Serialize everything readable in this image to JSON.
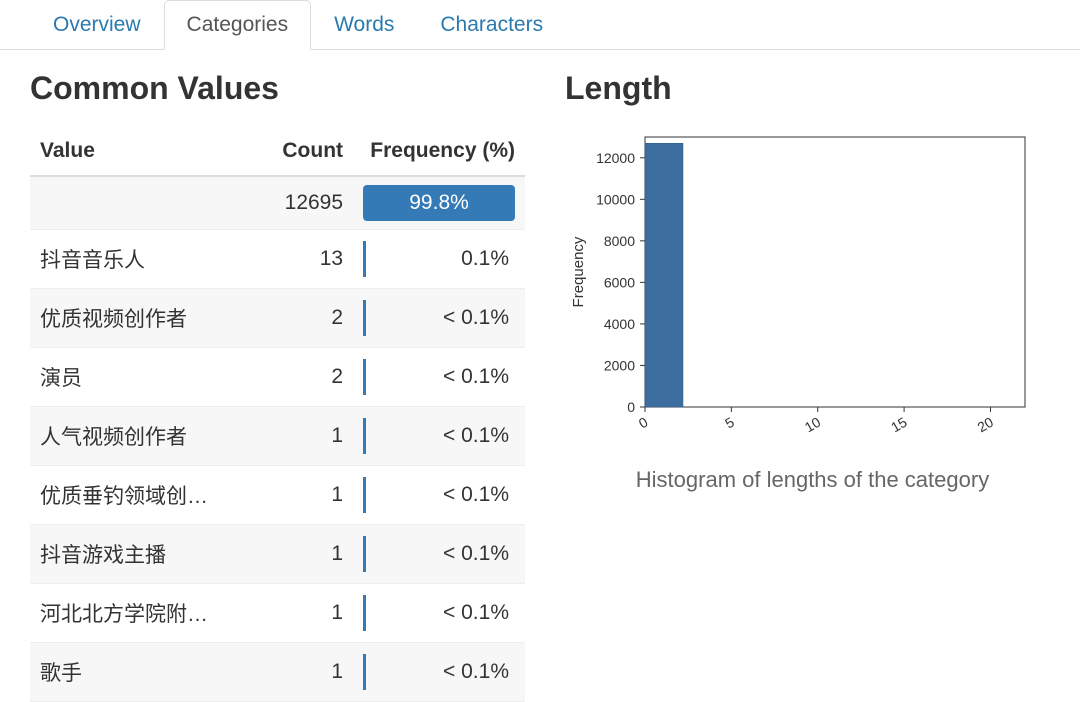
{
  "tabs": [
    {
      "label": "Overview",
      "active": false
    },
    {
      "label": "Categories",
      "active": true
    },
    {
      "label": "Words",
      "active": false
    },
    {
      "label": "Characters",
      "active": false
    }
  ],
  "left_title": "Common Values",
  "right_title": "Length",
  "columns": {
    "value": "Value",
    "count": "Count",
    "freq": "Frequency (%)"
  },
  "rows": [
    {
      "value": "",
      "count": "12695",
      "freq": "99.8%",
      "bar_pct": 99.8
    },
    {
      "value": "抖音音乐人",
      "count": "13",
      "freq": "0.1%",
      "bar_pct": 0.1
    },
    {
      "value": "优质视频创作者",
      "count": "2",
      "freq": "< 0.1%",
      "bar_pct": 0.05
    },
    {
      "value": "演员",
      "count": "2",
      "freq": "< 0.1%",
      "bar_pct": 0.05
    },
    {
      "value": "人气视频创作者",
      "count": "1",
      "freq": "< 0.1%",
      "bar_pct": 0.05
    },
    {
      "value": "优质垂钓领域创…",
      "count": "1",
      "freq": "< 0.1%",
      "bar_pct": 0.05
    },
    {
      "value": "抖音游戏主播",
      "count": "1",
      "freq": "< 0.1%",
      "bar_pct": 0.05
    },
    {
      "value": "河北北方学院附…",
      "count": "1",
      "freq": "< 0.1%",
      "bar_pct": 0.05
    },
    {
      "value": "歌手",
      "count": "1",
      "freq": "< 0.1%",
      "bar_pct": 0.05
    }
  ],
  "chart_caption": "Histogram of lengths of the category",
  "chart_data": {
    "type": "bar",
    "title": "",
    "xlabel": "",
    "ylabel": "Frequency",
    "x_ticks": [
      0,
      5,
      10,
      15,
      20
    ],
    "y_ticks": [
      0,
      2000,
      4000,
      6000,
      8000,
      10000,
      12000
    ],
    "xlim": [
      0,
      22
    ],
    "ylim": [
      0,
      13000
    ],
    "bars": [
      {
        "x_start": 0,
        "x_end": 2.2,
        "value": 12700
      }
    ]
  }
}
